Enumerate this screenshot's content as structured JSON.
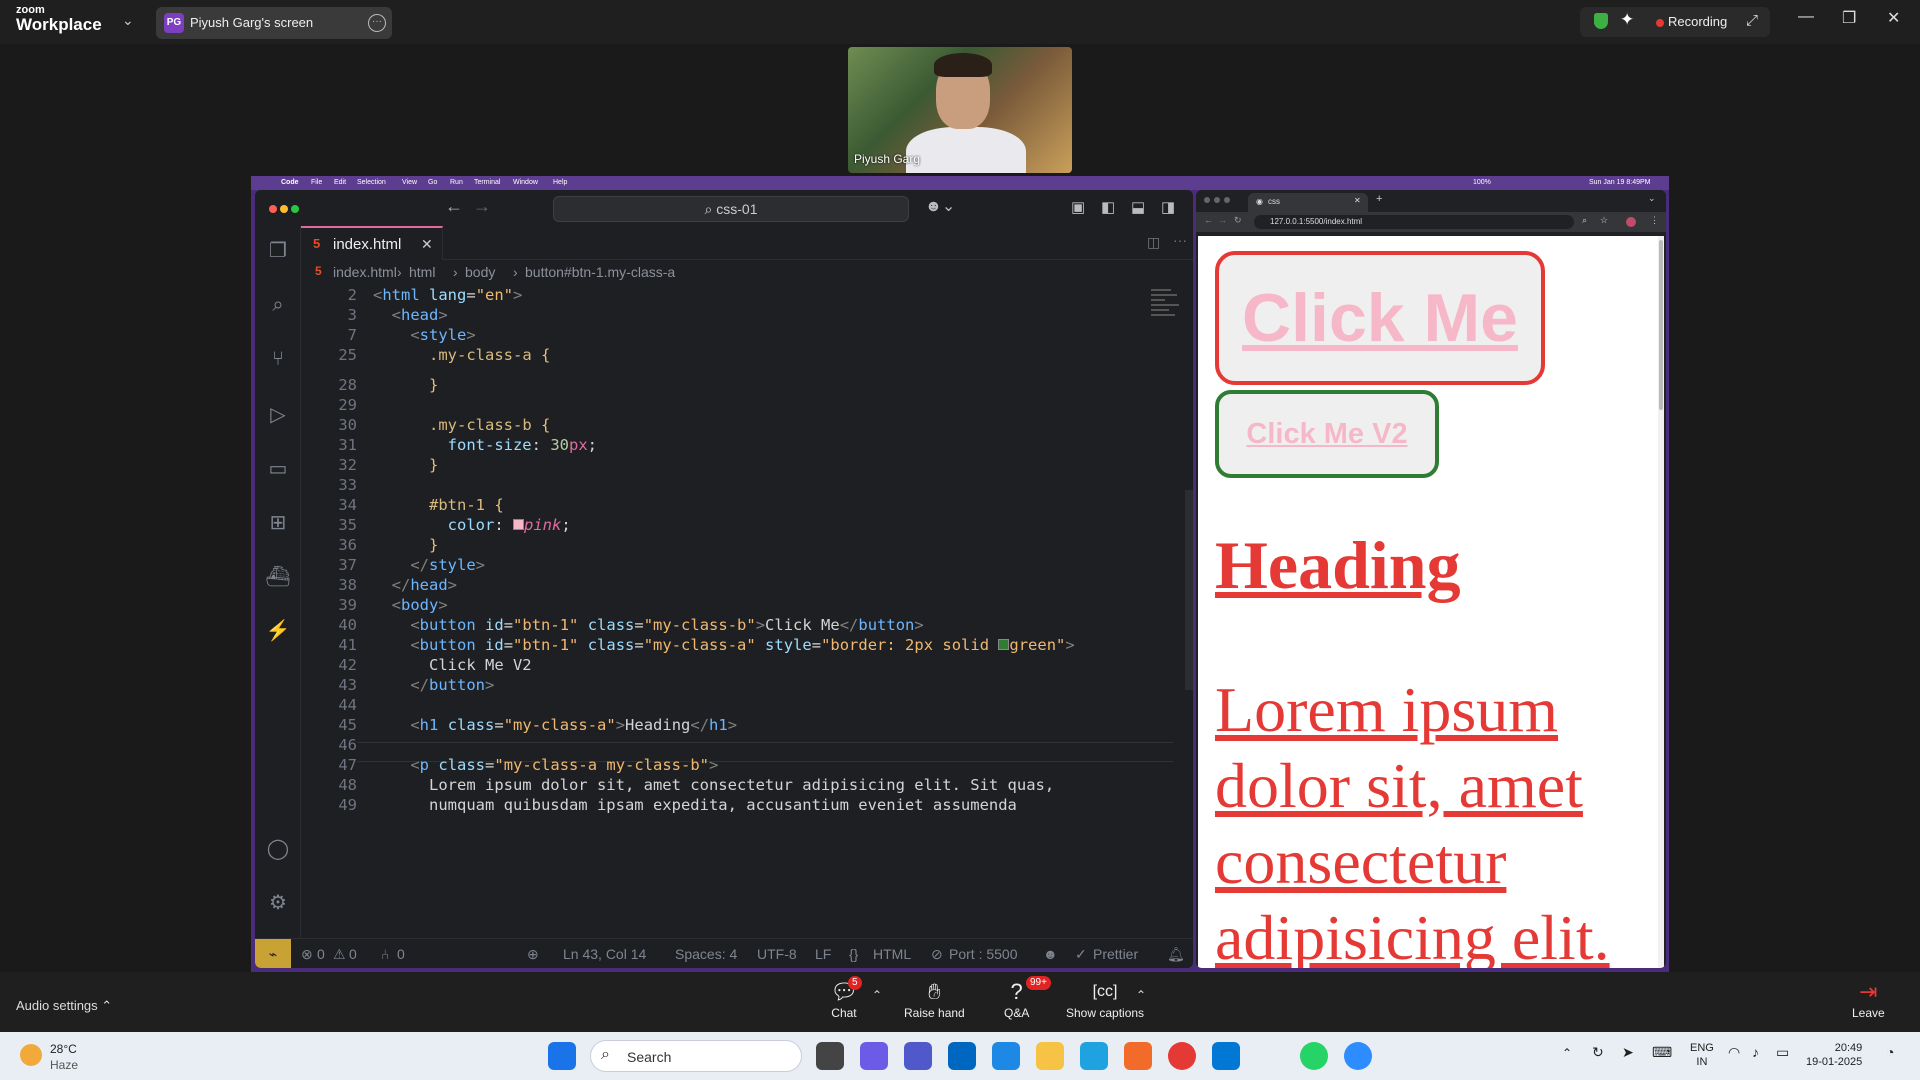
{
  "zoom": {
    "logo_line1": "zoom",
    "logo_line2": "Workplace",
    "share_avatar": "PG",
    "share_label": "Piyush Garg's screen",
    "recording": "Recording"
  },
  "participant": {
    "name": "Piyush Garg"
  },
  "mac_menu": [
    "Code",
    "File",
    "Edit",
    "Selection",
    "View",
    "Go",
    "Run",
    "Terminal",
    "Window",
    "Help"
  ],
  "mac_status": {
    "battery": "100%",
    "datetime": "Sun Jan 19  8:49PM"
  },
  "vscode": {
    "search": "css-01",
    "tab": "index.html",
    "breadcrumb": [
      "index.html",
      "html",
      "body",
      "button#btn-1.my-class-a"
    ],
    "lines": [
      {
        "n": "2"
      },
      {
        "n": "3"
      },
      {
        "n": "7"
      },
      {
        "n": "25"
      },
      {
        "n": "28"
      },
      {
        "n": "29"
      },
      {
        "n": "30"
      },
      {
        "n": "31"
      },
      {
        "n": "32"
      },
      {
        "n": "33"
      },
      {
        "n": "34"
      },
      {
        "n": "35"
      },
      {
        "n": "36"
      },
      {
        "n": "37"
      },
      {
        "n": "38"
      },
      {
        "n": "39"
      },
      {
        "n": "40"
      },
      {
        "n": "41"
      },
      {
        "n": "42"
      },
      {
        "n": "43"
      },
      {
        "n": "44"
      },
      {
        "n": "45"
      },
      {
        "n": "46"
      },
      {
        "n": "47"
      },
      {
        "n": "48"
      },
      {
        "n": "49"
      }
    ],
    "status": {
      "errors": "0",
      "warnings": "0",
      "ports": "0",
      "position": "Ln 43, Col 14",
      "spaces": "Spaces: 4",
      "encoding": "UTF-8",
      "eol": "LF",
      "language": "HTML",
      "port": "Port : 5500",
      "formatter": "Prettier"
    }
  },
  "browser": {
    "tab_title": "css",
    "url": "127.0.0.1:5500/index.html",
    "page": {
      "button1": "Click Me",
      "button2": "Click Me V2",
      "heading": "Heading",
      "paragraph": "Lorem ipsum dolor sit, amet consectetur adipisicing elit."
    }
  },
  "toolbar": {
    "audio": "Audio settings",
    "chat": "Chat",
    "chat_badge": "5",
    "raise_hand": "Raise hand",
    "qa": "Q&A",
    "qa_badge": "99+",
    "captions": "Show captions",
    "leave": "Leave"
  },
  "taskbar": {
    "temp": "28°C",
    "condition": "Haze",
    "search": "Search",
    "lang1": "ENG",
    "lang2": "IN",
    "time": "20:49",
    "date": "19-01-2025"
  },
  "colors": {
    "accent_red": "#e53935",
    "pink": "#f6b8c8",
    "green": "#2e7d32"
  }
}
